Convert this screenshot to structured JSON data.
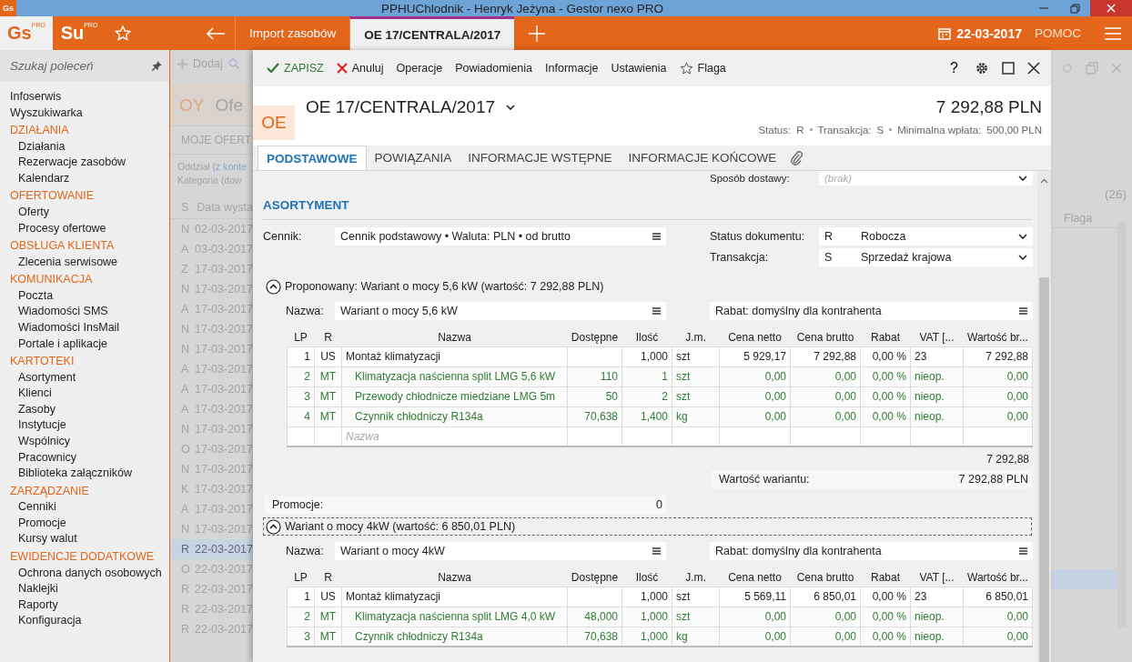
{
  "window": {
    "app_icon": "Gs",
    "title": "PPHUChlodnik - Henryk Jeżyna - Gestor nexo PRO"
  },
  "app_bar": {
    "logos": [
      {
        "text": "Gs",
        "sup": "PRO"
      },
      {
        "text": "Su",
        "sup": "PRO"
      }
    ],
    "tabs": [
      {
        "label": "Import zasobów",
        "selected": false
      },
      {
        "label": "OE 17/CENTRALA/2017",
        "selected": true
      }
    ],
    "date": "22-03-2017",
    "help": "POMOC"
  },
  "sidebar": {
    "search_placeholder": "Szukaj poleceń",
    "items": [
      {
        "label": "Infoserwis",
        "kind": "link"
      },
      {
        "label": "Wyszukiwarka",
        "kind": "link"
      },
      {
        "label": "DZIAŁANIA",
        "kind": "group",
        "children": [
          {
            "label": "Działania"
          },
          {
            "label": "Rezerwacje zasobów"
          },
          {
            "label": "Kalendarz"
          }
        ]
      },
      {
        "label": "OFERTOWANIE",
        "kind": "group",
        "children": [
          {
            "label": "Oferty"
          },
          {
            "label": "Procesy ofertowe"
          }
        ]
      },
      {
        "label": "OBSŁUGA KLIENTA",
        "kind": "group",
        "children": [
          {
            "label": "Zlecenia serwisowe"
          }
        ]
      },
      {
        "label": "KOMUNIKACJA",
        "kind": "group",
        "children": [
          {
            "label": "Poczta"
          },
          {
            "label": "Wiadomości SMS"
          },
          {
            "label": "Wiadomości InsMail"
          },
          {
            "label": "Portale i aplikacje"
          }
        ]
      },
      {
        "label": "KARTOTEKI",
        "kind": "group",
        "children": [
          {
            "label": "Asortyment"
          },
          {
            "label": "Klienci"
          },
          {
            "label": "Zasoby"
          },
          {
            "label": "Instytucje"
          },
          {
            "label": "Wspólnicy"
          },
          {
            "label": "Pracownicy"
          },
          {
            "label": "Biblioteka załączników"
          }
        ]
      },
      {
        "label": "ZARZĄDZANIE",
        "kind": "group",
        "children": [
          {
            "label": "Cenniki"
          },
          {
            "label": "Promocje"
          },
          {
            "label": "Kursy walut"
          }
        ]
      },
      {
        "label": "EWIDENCJE DODATKOWE",
        "kind": "group",
        "children": [
          {
            "label": "Ochrona danych osobowych"
          },
          {
            "label": "Naklejki"
          },
          {
            "label": "Raporty"
          },
          {
            "label": "Konfiguracja"
          }
        ]
      }
    ]
  },
  "background_list": {
    "add_label": "Dodaj",
    "code": "OY",
    "title": "Ofe",
    "tab": "MOJE OFERT",
    "filters": [
      {
        "label": "Oddział",
        "value": "(z konte",
        "link": true
      },
      {
        "label": "Kategoria",
        "value": "(dow",
        "link": false
      }
    ],
    "count": "(26)",
    "columns": [
      "S",
      "Data wysta"
    ],
    "flag_column": "Flaga",
    "rows": [
      {
        "s": "N",
        "date": "02-03-2017",
        "selected": false
      },
      {
        "s": "A",
        "date": "03-03-2017",
        "selected": false
      },
      {
        "s": "Z",
        "date": "17-03-2017",
        "selected": false
      },
      {
        "s": "N",
        "date": "17-03-2017",
        "selected": false
      },
      {
        "s": "A",
        "date": "17-03-2017",
        "selected": false
      },
      {
        "s": "N",
        "date": "17-03-2017",
        "selected": false
      },
      {
        "s": "N",
        "date": "17-03-2017",
        "selected": false
      },
      {
        "s": "A",
        "date": "17-03-2017",
        "selected": false
      },
      {
        "s": "A",
        "date": "17-03-2017",
        "selected": false
      },
      {
        "s": "A",
        "date": "17-03-2017",
        "selected": false
      },
      {
        "s": "N",
        "date": "17-03-2017",
        "selected": false
      },
      {
        "s": "O",
        "date": "17-03-2017",
        "selected": false
      },
      {
        "s": "N",
        "date": "17-03-2017",
        "selected": false
      },
      {
        "s": "K",
        "date": "17-03-2017",
        "selected": false
      },
      {
        "s": "A",
        "date": "17-03-2017",
        "selected": false
      },
      {
        "s": "N",
        "date": "17-03-2017",
        "selected": false
      },
      {
        "s": "R",
        "date": "22-03-2017",
        "selected": true
      },
      {
        "s": "O",
        "date": "22-03-2017",
        "selected": false
      },
      {
        "s": "R",
        "date": "22-03-2017",
        "selected": false
      },
      {
        "s": "R",
        "date": "22-03-2017",
        "selected": false
      },
      {
        "s": "R",
        "date": "22-03-2017",
        "selected": false
      }
    ]
  },
  "dialog": {
    "toolbar": [
      {
        "label": "ZAPISZ",
        "kind": "save"
      },
      {
        "label": "Anuluj",
        "kind": "cancel"
      },
      {
        "label": "Operacje",
        "kind": "plain"
      },
      {
        "label": "Powiadomienia",
        "kind": "plain"
      },
      {
        "label": "Informacje",
        "kind": "plain"
      },
      {
        "label": "Ustawienia",
        "kind": "plain"
      },
      {
        "label": "Flaga",
        "kind": "flag"
      }
    ],
    "help": "?",
    "badge": "OE",
    "title": "OE 17/CENTRALA/2017",
    "total": "7 292,88 PLN",
    "status_line": [
      {
        "label": "Status:",
        "value": "R"
      },
      {
        "label": "Transakcja:",
        "value": "S"
      },
      {
        "label": "Minimalna wpłata:",
        "value": "500,00 PLN"
      }
    ],
    "tabs": [
      {
        "label": "PODSTAWOWE",
        "selected": true
      },
      {
        "label": "POWIĄZANIA",
        "selected": false
      },
      {
        "label": "INFORMACJE WSTĘPNE",
        "selected": false
      },
      {
        "label": "INFORMACJE KOŃCOWE",
        "selected": false
      }
    ],
    "delivery": {
      "label": "Sposób dostawy:",
      "placeholder": "(brak)"
    },
    "section": "ASORTYMENT",
    "pricelist": {
      "label": "Cennik:",
      "value": "Cennik podstawowy • Waluta: PLN • od brutto"
    },
    "status": {
      "label": "Status dokumentu:",
      "code": "R",
      "value": "Robocza"
    },
    "transaction": {
      "label": "Transakcja:",
      "code": "S",
      "value": "Sprzedaż krajowa"
    },
    "variants": [
      {
        "header": "Proponowany: Wariant o mocy 5,6 kW (wartość: 7 292,88 PLN)",
        "focused": false,
        "name_label": "Nazwa:",
        "name": "Wariant o mocy 5,6 kW",
        "discount": "Rabat: domyślny dla kontrahenta",
        "columns": [
          "LP",
          "R",
          "Nazwa",
          "Dostępne",
          "Ilość",
          "J.m.",
          "Cena netto",
          "Cena brutto",
          "Rabat",
          "VAT [...",
          "Wartość br..."
        ],
        "rows": [
          {
            "kind": "service",
            "lp": "1",
            "r": "US",
            "name": "Montaż klimatyzacji",
            "qty": "1,000",
            "unit": "szt",
            "net": "5 929,17",
            "gross": "7 292,88",
            "discount": "0,00 %",
            "vat": "23",
            "value": "7 292,88"
          },
          {
            "kind": "material",
            "lp": "2",
            "r": "MT",
            "name": "Klimatyzacja naścienna split LMG 5,6 kW",
            "available": "110",
            "qty": "1",
            "unit": "szt",
            "net": "0,00",
            "gross": "0,00",
            "discount": "0,00 %",
            "vat": "nieop.",
            "value": "0,00"
          },
          {
            "kind": "material",
            "lp": "3",
            "r": "MT",
            "name": "Przewody chłodnicze miedziane LMG 5m",
            "available": "50",
            "qty": "2",
            "unit": "szt",
            "net": "0,00",
            "gross": "0,00",
            "discount": "0,00 %",
            "vat": "nieop.",
            "value": "0,00"
          },
          {
            "kind": "material",
            "lp": "4",
            "r": "MT",
            "name": "Czynnik chłodniczy R134a",
            "available": "70,638",
            "qty": "1,400",
            "unit": "kg",
            "net": "0,00",
            "gross": "0,00",
            "discount": "0,00 %",
            "vat": "nieop.",
            "value": "0,00"
          }
        ],
        "new_row_placeholder": "Nazwa",
        "subtotal": "7 292,88",
        "value_label": "Wartość wariantu:",
        "value": "7 292,88 PLN"
      },
      {
        "header": "Wariant o mocy 4kW (wartość: 6 850,01 PLN)",
        "focused": true,
        "name_label": "Nazwa:",
        "name": "Wariant o mocy 4kW",
        "discount": "Rabat: domyślny dla kontrahenta",
        "columns": [
          "LP",
          "R",
          "Nazwa",
          "Dostępne",
          "Ilość",
          "J.m.",
          "Cena netto",
          "Cena brutto",
          "Rabat",
          "VAT [...",
          "Wartość br..."
        ],
        "rows": [
          {
            "kind": "service",
            "lp": "1",
            "r": "US",
            "name": "Montaż klimatyzacji",
            "qty": "1,000",
            "unit": "szt",
            "net": "5 569,11",
            "gross": "6 850,01",
            "discount": "0,00 %",
            "vat": "23",
            "value": "6 850,01"
          },
          {
            "kind": "material",
            "lp": "2",
            "r": "MT",
            "name": "Klimatyzacja naścienna split LMG 4,0 kW",
            "available": "48,000",
            "qty": "1,000",
            "unit": "szt",
            "net": "0,00",
            "gross": "0,00",
            "discount": "0,00 %",
            "vat": "nieop.",
            "value": "0,00"
          },
          {
            "kind": "material",
            "lp": "3",
            "r": "MT",
            "name": "Czynnik chłodniczy R134a",
            "available": "70,638",
            "qty": "1,000",
            "unit": "kg",
            "net": "0,00",
            "gross": "0,00",
            "discount": "0,00 %",
            "vat": "nieop.",
            "value": "0,00"
          }
        ]
      }
    ],
    "promotions": {
      "label": "Promocje:",
      "value": "0"
    }
  }
}
